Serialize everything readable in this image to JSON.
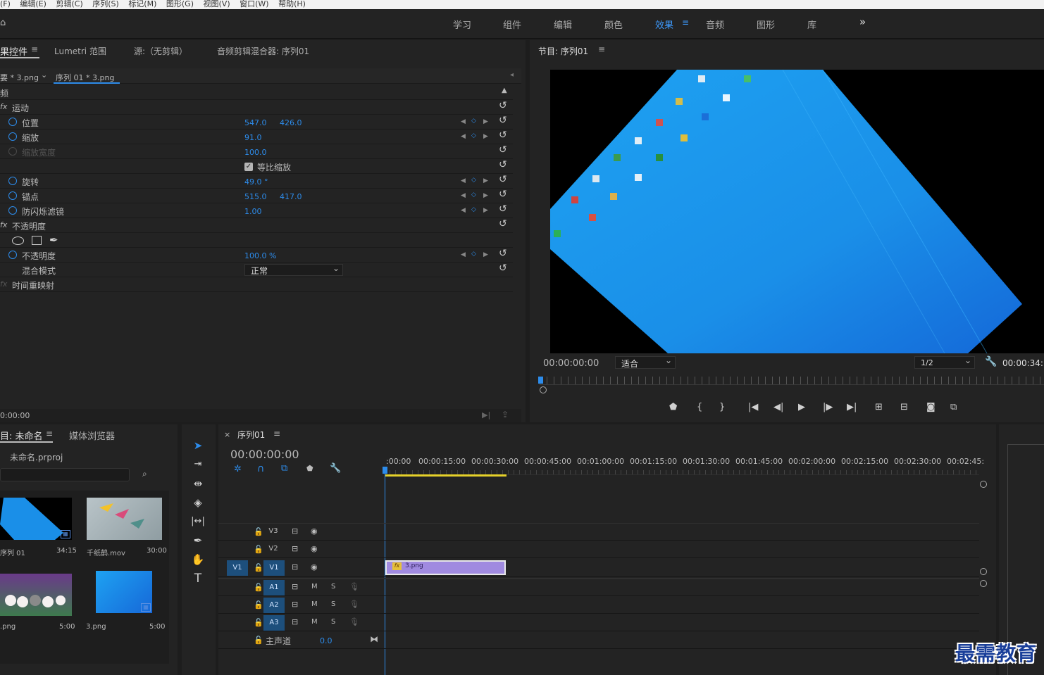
{
  "menubar": {
    "items": [
      "(F)",
      "编辑(E)",
      "剪辑(C)",
      "序列(S)",
      "标记(M)",
      "图形(G)",
      "视图(V)",
      "窗口(W)",
      "帮助(H)"
    ]
  },
  "workspaces": {
    "items": [
      "学习",
      "组件",
      "编辑",
      "颜色",
      "效果",
      "音频",
      "图形",
      "库"
    ],
    "active": "效果",
    "more": "»"
  },
  "effect_controls": {
    "tabs": [
      "果控件",
      "Lumetri 范围",
      "源:（无剪辑）",
      "音频剪辑混合器: 序列01"
    ],
    "source_clip": "要 * 3.png",
    "sequence_clip": "序列 01 * 3.png",
    "section_video": "频",
    "motion": "运动",
    "position": {
      "label": "位置",
      "x": "547.0",
      "y": "426.0"
    },
    "scale": {
      "label": "缩放",
      "value": "91.0"
    },
    "scale_width": {
      "label": "缩放宽度",
      "value": "100.0"
    },
    "uniform_scale": "等比缩放",
    "rotation": {
      "label": "旋转",
      "value": "49.0 °"
    },
    "anchor": {
      "label": "锚点",
      "x": "515.0",
      "y": "417.0"
    },
    "anti_flicker": {
      "label": "防闪烁滤镜",
      "value": "1.00"
    },
    "opacity_group": "不透明度",
    "opacity": {
      "label": "不透明度",
      "value": "100.0 %"
    },
    "blend_mode": {
      "label": "混合模式",
      "value": "正常"
    },
    "time_remap": "时间重映射",
    "timecode": "0:00:00"
  },
  "program_monitor": {
    "title": "节目: 序列01",
    "timecode": "00:00:00:00",
    "fit": "适合",
    "resolution": "1/2",
    "duration": "00:00:34:"
  },
  "project": {
    "title": "目: 未命名",
    "tab2": "媒体浏览器",
    "file": "未命名.prproj",
    "items": [
      {
        "name": "序列 01",
        "duration": "34:15"
      },
      {
        "name": "千纸鹤.mov",
        "duration": "30:00"
      },
      {
        "name": ".png",
        "duration": "5:00"
      },
      {
        "name": "3.png",
        "duration": "5:00"
      }
    ]
  },
  "timeline": {
    "title": "序列01",
    "timecode": "00:00:00:00",
    "ruler": [
      ":00:00",
      "00:00:15:00",
      "00:00:30:00",
      "00:00:45:00",
      "00:01:00:00",
      "00:01:15:00",
      "00:01:30:00",
      "00:01:45:00",
      "00:02:00:00",
      "00:02:15:00",
      "00:02:30:00",
      "00:02:45:"
    ],
    "video_tracks": [
      "V3",
      "V2",
      "V1"
    ],
    "audio_tracks": [
      "A1",
      "A2",
      "A3"
    ],
    "source_patch": "V1",
    "master": "主声道",
    "master_value": "0.0",
    "clip": "3.png",
    "m": "M",
    "s": "S"
  },
  "watermark": "最需教育",
  "colors": {
    "accent": "#2d8ceb",
    "clip": "#a08ae0",
    "desktop": "#1a8fe8"
  }
}
